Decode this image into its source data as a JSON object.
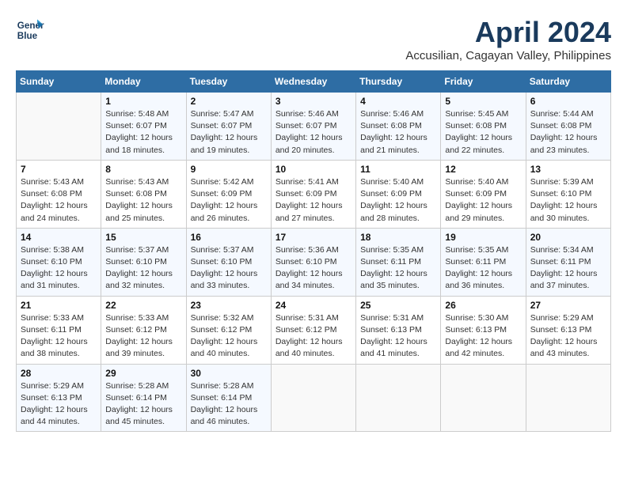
{
  "header": {
    "logo_line1": "General",
    "logo_line2": "Blue",
    "month": "April 2024",
    "location": "Accusilian, Cagayan Valley, Philippines"
  },
  "weekdays": [
    "Sunday",
    "Monday",
    "Tuesday",
    "Wednesday",
    "Thursday",
    "Friday",
    "Saturday"
  ],
  "weeks": [
    [
      {
        "day": "",
        "info": ""
      },
      {
        "day": "1",
        "info": "Sunrise: 5:48 AM\nSunset: 6:07 PM\nDaylight: 12 hours\nand 18 minutes."
      },
      {
        "day": "2",
        "info": "Sunrise: 5:47 AM\nSunset: 6:07 PM\nDaylight: 12 hours\nand 19 minutes."
      },
      {
        "day": "3",
        "info": "Sunrise: 5:46 AM\nSunset: 6:07 PM\nDaylight: 12 hours\nand 20 minutes."
      },
      {
        "day": "4",
        "info": "Sunrise: 5:46 AM\nSunset: 6:08 PM\nDaylight: 12 hours\nand 21 minutes."
      },
      {
        "day": "5",
        "info": "Sunrise: 5:45 AM\nSunset: 6:08 PM\nDaylight: 12 hours\nand 22 minutes."
      },
      {
        "day": "6",
        "info": "Sunrise: 5:44 AM\nSunset: 6:08 PM\nDaylight: 12 hours\nand 23 minutes."
      }
    ],
    [
      {
        "day": "7",
        "info": "Sunrise: 5:43 AM\nSunset: 6:08 PM\nDaylight: 12 hours\nand 24 minutes."
      },
      {
        "day": "8",
        "info": "Sunrise: 5:43 AM\nSunset: 6:08 PM\nDaylight: 12 hours\nand 25 minutes."
      },
      {
        "day": "9",
        "info": "Sunrise: 5:42 AM\nSunset: 6:09 PM\nDaylight: 12 hours\nand 26 minutes."
      },
      {
        "day": "10",
        "info": "Sunrise: 5:41 AM\nSunset: 6:09 PM\nDaylight: 12 hours\nand 27 minutes."
      },
      {
        "day": "11",
        "info": "Sunrise: 5:40 AM\nSunset: 6:09 PM\nDaylight: 12 hours\nand 28 minutes."
      },
      {
        "day": "12",
        "info": "Sunrise: 5:40 AM\nSunset: 6:09 PM\nDaylight: 12 hours\nand 29 minutes."
      },
      {
        "day": "13",
        "info": "Sunrise: 5:39 AM\nSunset: 6:10 PM\nDaylight: 12 hours\nand 30 minutes."
      }
    ],
    [
      {
        "day": "14",
        "info": "Sunrise: 5:38 AM\nSunset: 6:10 PM\nDaylight: 12 hours\nand 31 minutes."
      },
      {
        "day": "15",
        "info": "Sunrise: 5:37 AM\nSunset: 6:10 PM\nDaylight: 12 hours\nand 32 minutes."
      },
      {
        "day": "16",
        "info": "Sunrise: 5:37 AM\nSunset: 6:10 PM\nDaylight: 12 hours\nand 33 minutes."
      },
      {
        "day": "17",
        "info": "Sunrise: 5:36 AM\nSunset: 6:10 PM\nDaylight: 12 hours\nand 34 minutes."
      },
      {
        "day": "18",
        "info": "Sunrise: 5:35 AM\nSunset: 6:11 PM\nDaylight: 12 hours\nand 35 minutes."
      },
      {
        "day": "19",
        "info": "Sunrise: 5:35 AM\nSunset: 6:11 PM\nDaylight: 12 hours\nand 36 minutes."
      },
      {
        "day": "20",
        "info": "Sunrise: 5:34 AM\nSunset: 6:11 PM\nDaylight: 12 hours\nand 37 minutes."
      }
    ],
    [
      {
        "day": "21",
        "info": "Sunrise: 5:33 AM\nSunset: 6:11 PM\nDaylight: 12 hours\nand 38 minutes."
      },
      {
        "day": "22",
        "info": "Sunrise: 5:33 AM\nSunset: 6:12 PM\nDaylight: 12 hours\nand 39 minutes."
      },
      {
        "day": "23",
        "info": "Sunrise: 5:32 AM\nSunset: 6:12 PM\nDaylight: 12 hours\nand 40 minutes."
      },
      {
        "day": "24",
        "info": "Sunrise: 5:31 AM\nSunset: 6:12 PM\nDaylight: 12 hours\nand 40 minutes."
      },
      {
        "day": "25",
        "info": "Sunrise: 5:31 AM\nSunset: 6:13 PM\nDaylight: 12 hours\nand 41 minutes."
      },
      {
        "day": "26",
        "info": "Sunrise: 5:30 AM\nSunset: 6:13 PM\nDaylight: 12 hours\nand 42 minutes."
      },
      {
        "day": "27",
        "info": "Sunrise: 5:29 AM\nSunset: 6:13 PM\nDaylight: 12 hours\nand 43 minutes."
      }
    ],
    [
      {
        "day": "28",
        "info": "Sunrise: 5:29 AM\nSunset: 6:13 PM\nDaylight: 12 hours\nand 44 minutes."
      },
      {
        "day": "29",
        "info": "Sunrise: 5:28 AM\nSunset: 6:14 PM\nDaylight: 12 hours\nand 45 minutes."
      },
      {
        "day": "30",
        "info": "Sunrise: 5:28 AM\nSunset: 6:14 PM\nDaylight: 12 hours\nand 46 minutes."
      },
      {
        "day": "",
        "info": ""
      },
      {
        "day": "",
        "info": ""
      },
      {
        "day": "",
        "info": ""
      },
      {
        "day": "",
        "info": ""
      }
    ]
  ]
}
